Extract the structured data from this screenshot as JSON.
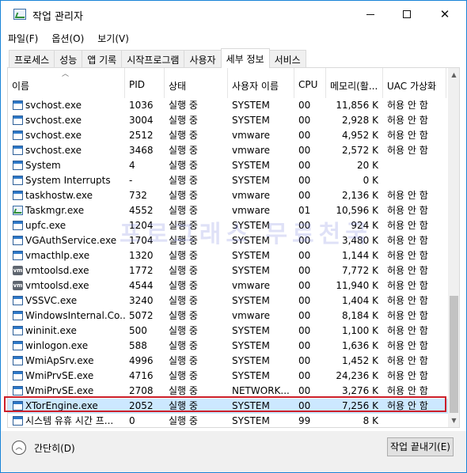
{
  "window": {
    "title": "작업 관리자"
  },
  "menu": [
    {
      "label": "파일(F)"
    },
    {
      "label": "옵션(O)"
    },
    {
      "label": "보기(V)"
    }
  ],
  "tabs": [
    {
      "label": "프로세스"
    },
    {
      "label": "성능"
    },
    {
      "label": "앱 기록"
    },
    {
      "label": "시작프로그램"
    },
    {
      "label": "사용자"
    },
    {
      "label": "세부 정보",
      "active": true
    },
    {
      "label": "서비스"
    }
  ],
  "columns": {
    "name": "이름",
    "pid": "PID",
    "status": "상태",
    "user": "사용자 이름",
    "cpu": "CPU",
    "memory": "메모리(활...",
    "uac": "UAC 가상화"
  },
  "watermark": "프로그래스 무료천국",
  "processes": [
    {
      "icon": "app",
      "name": "svchost.exe",
      "pid": "1036",
      "status": "실행 중",
      "user": "SYSTEM",
      "cpu": "00",
      "memory": "11,856 K",
      "uac": "허용 안 함"
    },
    {
      "icon": "app",
      "name": "svchost.exe",
      "pid": "3004",
      "status": "실행 중",
      "user": "SYSTEM",
      "cpu": "00",
      "memory": "2,928 K",
      "uac": "허용 안 함"
    },
    {
      "icon": "app",
      "name": "svchost.exe",
      "pid": "2512",
      "status": "실행 중",
      "user": "vmware",
      "cpu": "00",
      "memory": "4,952 K",
      "uac": "허용 안 함"
    },
    {
      "icon": "app",
      "name": "svchost.exe",
      "pid": "3468",
      "status": "실행 중",
      "user": "vmware",
      "cpu": "00",
      "memory": "2,572 K",
      "uac": "허용 안 함"
    },
    {
      "icon": "app",
      "name": "System",
      "pid": "4",
      "status": "실행 중",
      "user": "SYSTEM",
      "cpu": "00",
      "memory": "20 K",
      "uac": ""
    },
    {
      "icon": "app",
      "name": "System Interrupts",
      "pid": "-",
      "status": "실행 중",
      "user": "SYSTEM",
      "cpu": "00",
      "memory": "0 K",
      "uac": ""
    },
    {
      "icon": "app",
      "name": "taskhostw.exe",
      "pid": "732",
      "status": "실행 중",
      "user": "vmware",
      "cpu": "00",
      "memory": "2,136 K",
      "uac": "허용 안 함"
    },
    {
      "icon": "tm",
      "name": "Taskmgr.exe",
      "pid": "4552",
      "status": "실행 중",
      "user": "vmware",
      "cpu": "01",
      "memory": "10,596 K",
      "uac": "허용 안 함"
    },
    {
      "icon": "app",
      "name": "upfc.exe",
      "pid": "1204",
      "status": "실행 중",
      "user": "SYSTEM",
      "cpu": "00",
      "memory": "924 K",
      "uac": "허용 안 함"
    },
    {
      "icon": "app",
      "name": "VGAuthService.exe",
      "pid": "1704",
      "status": "실행 중",
      "user": "SYSTEM",
      "cpu": "00",
      "memory": "3,480 K",
      "uac": "허용 안 함"
    },
    {
      "icon": "app",
      "name": "vmacthlp.exe",
      "pid": "1320",
      "status": "실행 중",
      "user": "SYSTEM",
      "cpu": "00",
      "memory": "1,144 K",
      "uac": "허용 안 함"
    },
    {
      "icon": "vm",
      "name": "vmtoolsd.exe",
      "pid": "1772",
      "status": "실행 중",
      "user": "SYSTEM",
      "cpu": "00",
      "memory": "7,772 K",
      "uac": "허용 안 함"
    },
    {
      "icon": "vm",
      "name": "vmtoolsd.exe",
      "pid": "4544",
      "status": "실행 중",
      "user": "vmware",
      "cpu": "00",
      "memory": "11,940 K",
      "uac": "허용 안 함"
    },
    {
      "icon": "app",
      "name": "VSSVC.exe",
      "pid": "3240",
      "status": "실행 중",
      "user": "SYSTEM",
      "cpu": "00",
      "memory": "1,404 K",
      "uac": "허용 안 함"
    },
    {
      "icon": "app",
      "name": "WindowsInternal.Co...",
      "pid": "5072",
      "status": "실행 중",
      "user": "vmware",
      "cpu": "00",
      "memory": "8,184 K",
      "uac": "허용 안 함"
    },
    {
      "icon": "app",
      "name": "wininit.exe",
      "pid": "500",
      "status": "실행 중",
      "user": "SYSTEM",
      "cpu": "00",
      "memory": "1,100 K",
      "uac": "허용 안 함"
    },
    {
      "icon": "app",
      "name": "winlogon.exe",
      "pid": "588",
      "status": "실행 중",
      "user": "SYSTEM",
      "cpu": "00",
      "memory": "1,636 K",
      "uac": "허용 안 함"
    },
    {
      "icon": "app",
      "name": "WmiApSrv.exe",
      "pid": "4996",
      "status": "실행 중",
      "user": "SYSTEM",
      "cpu": "00",
      "memory": "1,452 K",
      "uac": "허용 안 함"
    },
    {
      "icon": "app",
      "name": "WmiPrvSE.exe",
      "pid": "4716",
      "status": "실행 중",
      "user": "SYSTEM",
      "cpu": "00",
      "memory": "24,236 K",
      "uac": "허용 안 함"
    },
    {
      "icon": "app",
      "name": "WmiPrvSE.exe",
      "pid": "2708",
      "status": "실행 중",
      "user": "NETWORK...",
      "cpu": "00",
      "memory": "3,276 K",
      "uac": "허용 안 함"
    },
    {
      "icon": "app",
      "name": "XTorEngine.exe",
      "pid": "2052",
      "status": "실행 중",
      "user": "SYSTEM",
      "cpu": "00",
      "memory": "7,256 K",
      "uac": "허용 안 함",
      "selected": true
    },
    {
      "icon": "app",
      "name": "시스템 유휴 시간 프...",
      "pid": "0",
      "status": "실행 중",
      "user": "SYSTEM",
      "cpu": "99",
      "memory": "8 K",
      "uac": ""
    }
  ],
  "footer": {
    "fewer_details": "간단히(D)",
    "end_task": "작업 끝내기(E)"
  }
}
